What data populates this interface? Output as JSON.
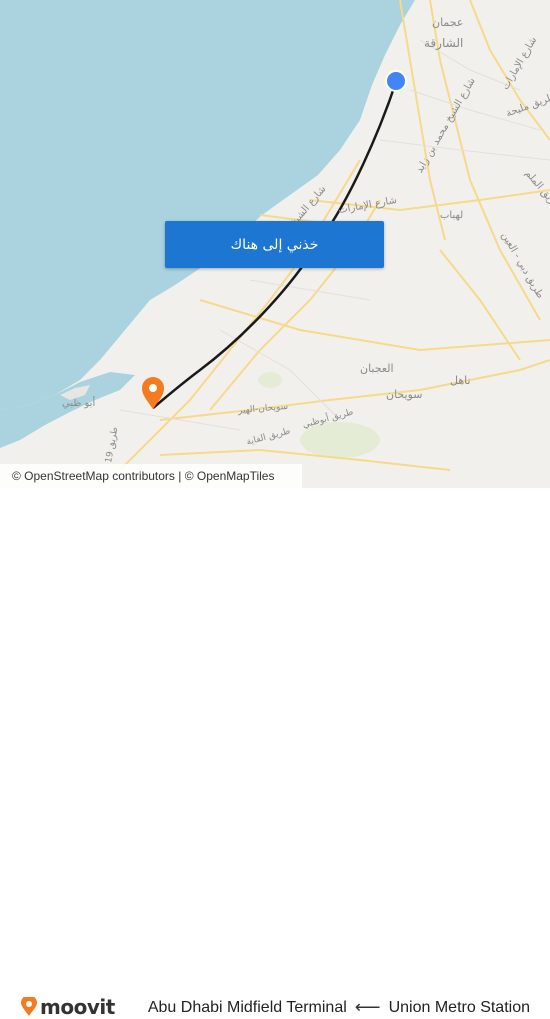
{
  "map": {
    "labels": {
      "sharjah": "الشارقة",
      "ajman": "عجمان",
      "emirates_road": "شارع الإمارات",
      "maliha_road": "طريق مليحة",
      "sheikh_mohammed_road": "شارع الشيخ محمد بن زايد",
      "sheikh_zayed_road": "شارع الشيخ زايد",
      "emirates_road_2": "شارع الإمارات",
      "al_qudra": "شارع الخيل",
      "lehbab": "لهباب",
      "al_ain_road": "طريق دبي - العين",
      "al_faqa": "الفقع",
      "al_ajban": "العجبان",
      "sweihan": "سويحان",
      "nahel": "ناهل",
      "sweihan_road": "سويحان-الهير",
      "abudhabi_road": "طريق أبوظبي",
      "abu_dhabi": "أبو ظبي",
      "khalifa_road": "طريق الفاية",
      "road_19": "طريق 19",
      "mleiha": "طريق الملم",
      "umm_al_quwain": "مليحة"
    },
    "origin_name": "Union Metro Station",
    "destination_name": "Abu Dhabi Midfield Terminal",
    "colors": {
      "water": "#aad3df",
      "land": "#f2f0ec",
      "route": "#1a1a1a",
      "origin": "#4285f4",
      "destination": "#f47b20"
    }
  },
  "cta": {
    "label": "خذني إلى هناك"
  },
  "attribution": {
    "text": "© OpenStreetMap contributors | © OpenMapTiles"
  },
  "footer": {
    "brand": "moovit",
    "brand_color": "#f47b20",
    "route_destination": "Abu Dhabi Midfield Terminal",
    "route_arrow": "⟵",
    "route_origin": "Union Metro Station"
  }
}
